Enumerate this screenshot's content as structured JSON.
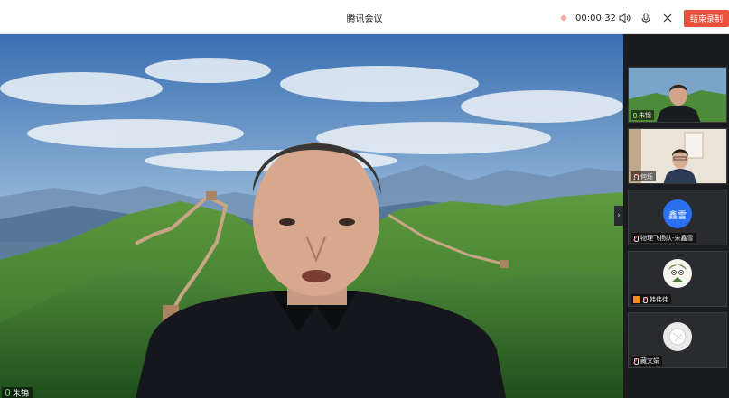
{
  "window": {
    "title": "腾讯会议"
  },
  "recording": {
    "time": "00:00:32",
    "end_label": "结束录制"
  },
  "main": {
    "speaker_name": "朱锦"
  },
  "participants": [
    {
      "name": "朱锦",
      "status": "mic-on",
      "kind": "video"
    },
    {
      "name": "何烁",
      "status": "mic-off",
      "kind": "video"
    },
    {
      "name": "物理飞扬队-宋鑫雪",
      "status": "mic-off",
      "kind": "avatar",
      "avatar_text": "鑫雪",
      "avatar_color": "#2a6ff0"
    },
    {
      "name": "韩伟伟",
      "status": "mic-off",
      "kind": "avatar-image"
    },
    {
      "name": "藏文娟",
      "status": "mic-off",
      "kind": "avatar-image"
    }
  ],
  "colors": {
    "accent": "#e8513b",
    "avatar_blue": "#2a6ff0"
  }
}
